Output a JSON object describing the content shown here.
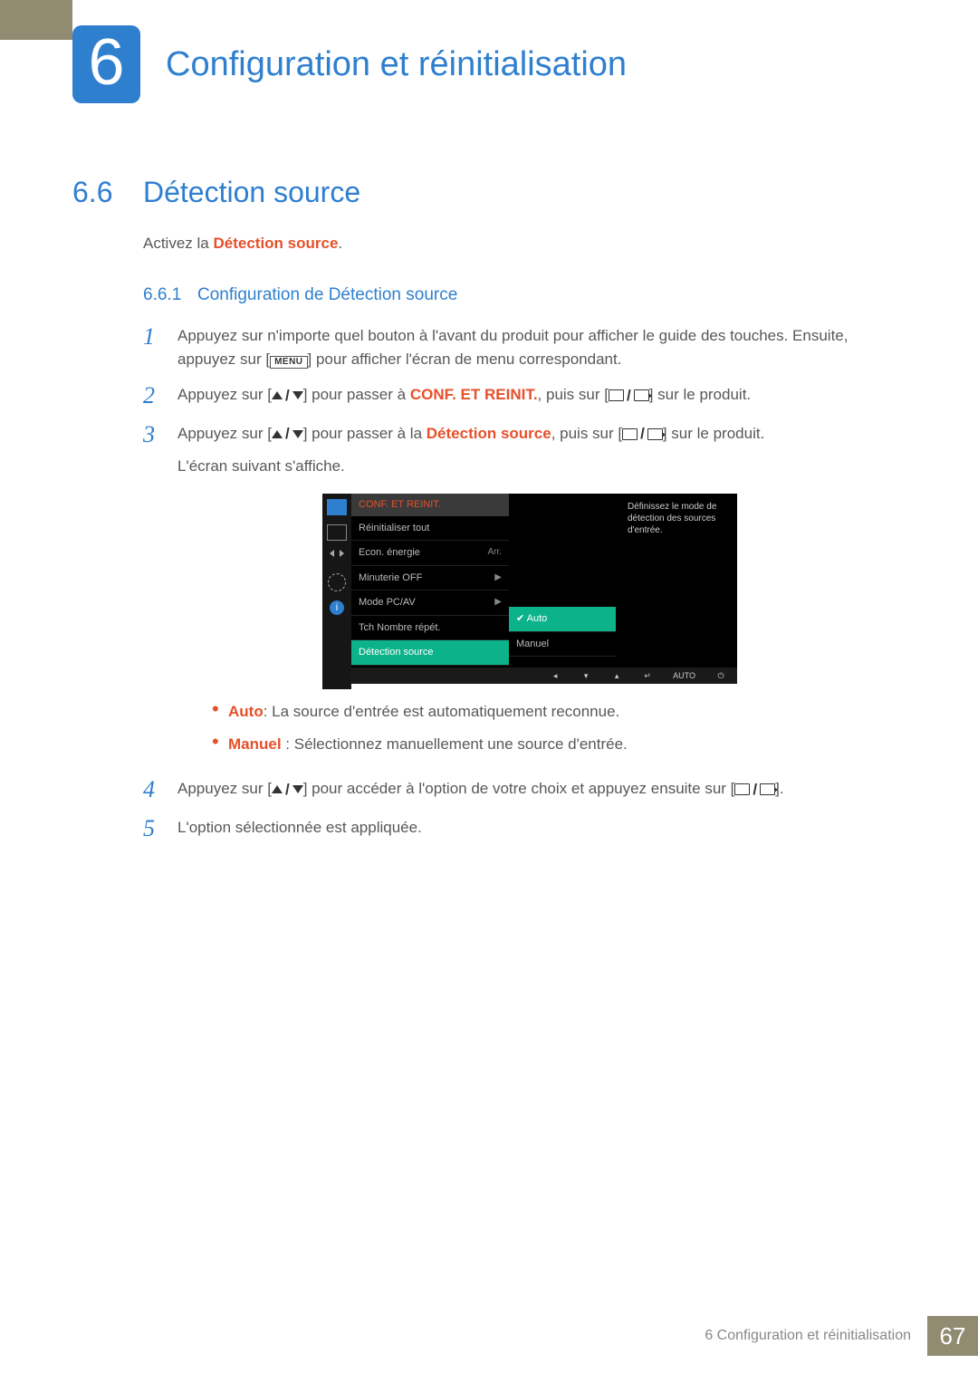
{
  "chapter": {
    "num": "6",
    "title": "Configuration et réinitialisation"
  },
  "section": {
    "num": "6.6",
    "title": "Détection source"
  },
  "intro_prefix": "Activez la ",
  "intro_bold": "Détection source",
  "intro_suffix": ".",
  "subsection": {
    "num": "6.6.1",
    "title": "Configuration de Détection source"
  },
  "steps": {
    "s1a": "Appuyez sur n'importe quel bouton à l'avant du produit pour afficher le guide des touches. Ensuite, appuyez sur [",
    "s1_menu": "MENU",
    "s1b": "] pour afficher l'écran de menu correspondant.",
    "s2a": "Appuyez sur [",
    "s2b": "] pour passer à ",
    "s2_bold": "CONF. ET REINIT.",
    "s2c": ", puis sur [",
    "s2d": "] sur le produit.",
    "s3a": "Appuyez sur [",
    "s3b": "] pour passer à la ",
    "s3_bold": "Détection source",
    "s3c": ", puis sur [",
    "s3d": "] sur le produit.",
    "s3_tail": "L'écran suivant s'affiche.",
    "b1_bold": "Auto",
    "b1": ": La source d'entrée est automatiquement reconnue.",
    "b2_bold": "Manuel",
    "b2": " : Sélectionnez manuellement une source d'entrée.",
    "s4a": "Appuyez sur [",
    "s4b": "] pour accéder à l'option de votre choix et appuyez ensuite sur [",
    "s4c": "].",
    "s5": "L'option sélectionnée est appliquée."
  },
  "step_nums": {
    "1": "1",
    "2": "2",
    "3": "3",
    "4": "4",
    "5": "5"
  },
  "osd": {
    "title": "CONF. ET REINIT.",
    "items": [
      {
        "label": "Réinitialiser tout",
        "val": ""
      },
      {
        "label": "Econ. énergie",
        "val": "Arr."
      },
      {
        "label": "Minuterie OFF",
        "val": "▶"
      },
      {
        "label": "Mode PC/AV",
        "val": "▶"
      },
      {
        "label": "Tch Nombre répét.",
        "val": ""
      },
      {
        "label": "Détection source",
        "val": ""
      }
    ],
    "opts": [
      "Auto",
      "Manuel"
    ],
    "desc": "Définissez le mode de détection des sources d'entrée.",
    "bar_auto": "AUTO"
  },
  "footer": {
    "chapter": "6 Configuration et réinitialisation",
    "page": "67"
  }
}
